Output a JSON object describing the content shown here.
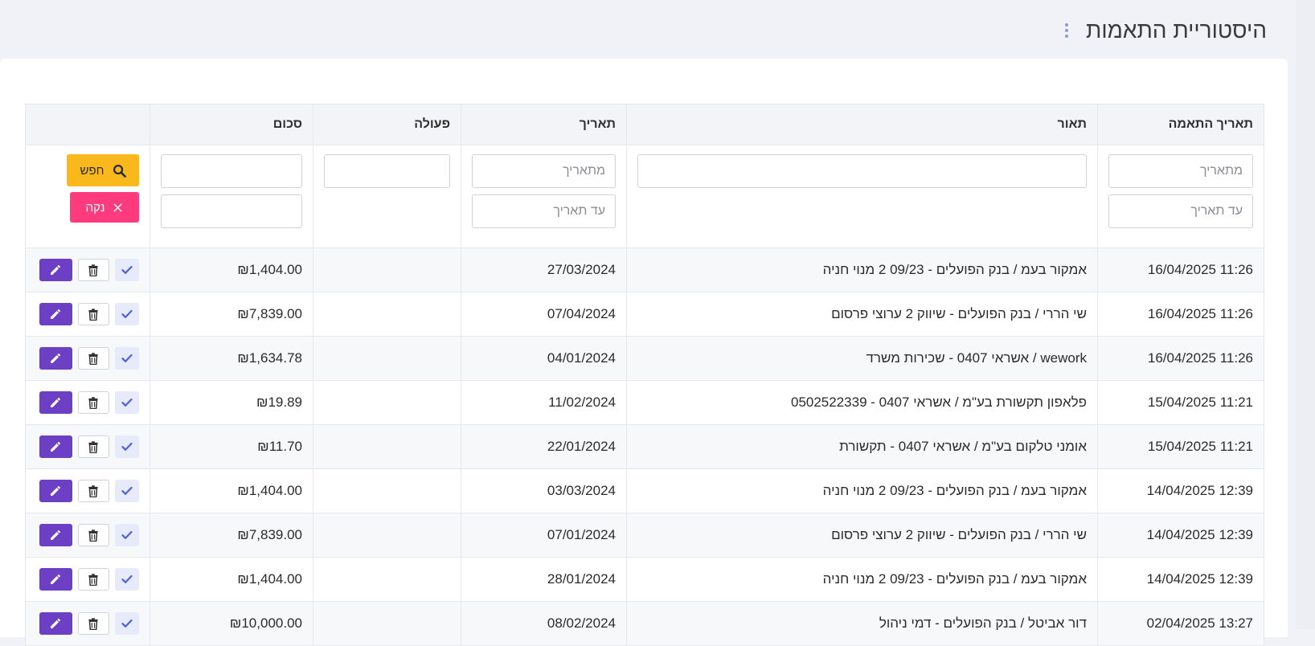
{
  "page": {
    "title": "היסטוריית התאמות"
  },
  "table": {
    "columns": {
      "match_date": "תאריך התאמה",
      "description": "תאור",
      "date": "תאריך",
      "action": "פעולה",
      "amount": "סכום"
    },
    "filters": {
      "from_date_placeholder": "מתאריך",
      "to_date_placeholder": "עד תאריך",
      "search_label": "חפש",
      "clear_label": "נקה"
    },
    "rows": [
      {
        "match_date": "11:26 16/04/2025",
        "description": "אמקור בעמ / בנק הפועלים - 09/23 2 מנוי חניה",
        "date": "27/03/2024",
        "action": "",
        "amount": "₪1,404.00"
      },
      {
        "match_date": "11:26 16/04/2025",
        "description": "שי הררי / בנק הפועלים - שיווק 2 ערוצי פרסום",
        "date": "07/04/2024",
        "action": "",
        "amount": "₪7,839.00"
      },
      {
        "match_date": "11:26 16/04/2025",
        "description": "wework / אשראי 0407 - שכירות משרד",
        "date": "04/01/2024",
        "action": "",
        "amount": "₪1,634.78"
      },
      {
        "match_date": "11:21 15/04/2025",
        "description": "פלאפון תקשורת בע\"מ / אשראי 0407 - 0502522339",
        "date": "11/02/2024",
        "action": "",
        "amount": "₪19.89"
      },
      {
        "match_date": "11:21 15/04/2025",
        "description": "אומני טלקום בע\"מ / אשראי 0407 - תקשורת",
        "date": "22/01/2024",
        "action": "",
        "amount": "₪11.70"
      },
      {
        "match_date": "12:39 14/04/2025",
        "description": "אמקור בעמ / בנק הפועלים - 09/23 2 מנוי חניה",
        "date": "03/03/2024",
        "action": "",
        "amount": "₪1,404.00"
      },
      {
        "match_date": "12:39 14/04/2025",
        "description": "שי הררי / בנק הפועלים - שיווק 2 ערוצי פרסום",
        "date": "07/01/2024",
        "action": "",
        "amount": "₪7,839.00"
      },
      {
        "match_date": "12:39 14/04/2025",
        "description": "אמקור בעמ / בנק הפועלים - 09/23 2 מנוי חניה",
        "date": "28/01/2024",
        "action": "",
        "amount": "₪1,404.00"
      },
      {
        "match_date": "13:27 02/04/2025",
        "description": "דור אביטל / בנק הפועלים - דמי ניהול",
        "date": "08/02/2024",
        "action": "",
        "amount": "₪10,000.00"
      }
    ]
  },
  "colors": {
    "search_button": "#f9b81c",
    "clear_button": "#ff3a7d",
    "edit_button": "#6c3fc5",
    "confirm_button_bg": "#e7eafb",
    "confirm_icon": "#4a63d8"
  },
  "icons": {
    "search": "search-icon",
    "clear": "close-icon",
    "edit": "pencil-icon",
    "delete": "trash-icon",
    "confirm": "check-icon",
    "menu": "kebab-menu-icon"
  }
}
